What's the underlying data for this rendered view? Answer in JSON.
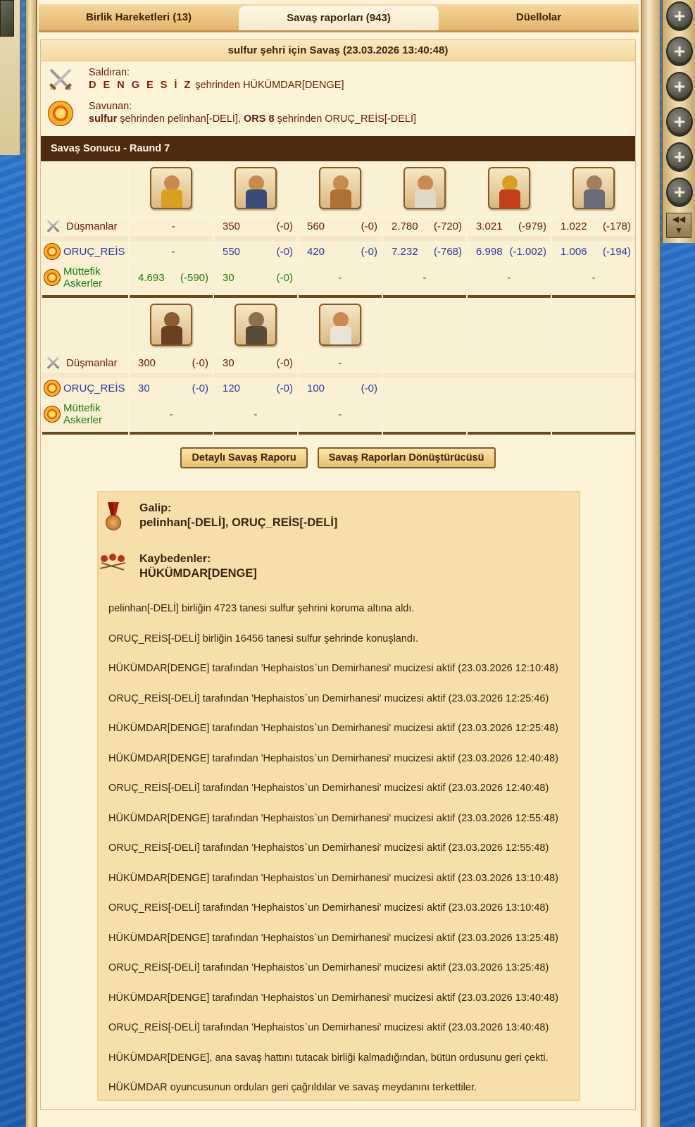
{
  "tabs": [
    {
      "label": "Birlik Hareketleri (13)"
    },
    {
      "label": "Savaş raporları (943)"
    },
    {
      "label": "Düellolar"
    }
  ],
  "report": {
    "title": "sulfur şehri için Savaş (23.03.2026 13:40:48)",
    "attacker_label": "Saldıran:",
    "attacker_city": "D E N G E S İ Z",
    "attacker_rest": " şehrinden HÜKÜMDAR[DENGE]",
    "defender_label": "Savunan:",
    "defender_city1": "sulfur",
    "defender_rest1": " şehrinden pelinhan[-DELİ], ",
    "defender_city2": "ORS 8",
    "defender_rest2": " şehrinden ORUÇ_REİS[-DELİ]",
    "result_bar": "Savaş Sonucu - Raund 7"
  },
  "rows": {
    "enemies": "Düşmanlar",
    "own": "ORUÇ_REİS",
    "allies": "Müttefik Askerler"
  },
  "block1": {
    "enemies": [
      [
        "-",
        ""
      ],
      [
        "350",
        "(-0)"
      ],
      [
        "560",
        "(-0)"
      ],
      [
        "2.780",
        "(-720)"
      ],
      [
        "3.021",
        "(-979)"
      ],
      [
        "1.022",
        "(-178)"
      ]
    ],
    "own": [
      [
        "-",
        ""
      ],
      [
        "550",
        "(-0)"
      ],
      [
        "420",
        "(-0)"
      ],
      [
        "7.232",
        "(-768)"
      ],
      [
        "6.998",
        "(-1.002)"
      ],
      [
        "1.006",
        "(-194)"
      ]
    ],
    "allies": [
      [
        "4.693",
        "(-590)"
      ],
      [
        "30",
        "(-0)"
      ],
      [
        "-",
        ""
      ],
      [
        "-",
        ""
      ],
      [
        "-",
        ""
      ],
      [
        "-",
        ""
      ]
    ]
  },
  "block2": {
    "enemies": [
      [
        "300",
        "(-0)"
      ],
      [
        "30",
        "(-0)"
      ],
      [
        "-",
        ""
      ]
    ],
    "own": [
      [
        "30",
        "(-0)"
      ],
      [
        "120",
        "(-0)"
      ],
      [
        "100",
        "(-0)"
      ]
    ],
    "allies": [
      [
        "-",
        ""
      ],
      [
        "-",
        ""
      ],
      [
        "-",
        ""
      ]
    ]
  },
  "buttons": {
    "detailed": "Detaylı Savaş Raporu",
    "converter": "Savaş Raporları Dönüştürücüsü"
  },
  "result": {
    "winner_label": "Galip:",
    "winners": "pelinhan[-DELİ], ORUÇ_REİS[-DELİ]",
    "loser_label": "Kaybedenler:",
    "losers": "HÜKÜMDAR[DENGE]"
  },
  "events": [
    "pelinhan[-DELİ] birliğin 4723 tanesi sulfur şehrini koruma altına aldı.",
    "ORUÇ_REİS[-DELİ] birliğin 16456 tanesi sulfur şehrinde konuşlandı.",
    "HÜKÜMDAR[DENGE] tarafından 'Hephaistos`un Demirhanesi' mucizesi aktif (23.03.2026 12:10:48)",
    "ORUÇ_REİS[-DELİ] tarafından 'Hephaistos`un Demirhanesi' mucizesi aktif (23.03.2026 12:25:46)",
    "HÜKÜMDAR[DENGE] tarafından 'Hephaistos`un Demirhanesi' mucizesi aktif (23.03.2026 12:25:48)",
    "HÜKÜMDAR[DENGE] tarafından 'Hephaistos`un Demirhanesi' mucizesi aktif (23.03.2026 12:40:48)",
    "ORUÇ_REİS[-DELİ] tarafından 'Hephaistos`un Demirhanesi' mucizesi aktif (23.03.2026 12:40:48)",
    "HÜKÜMDAR[DENGE] tarafından 'Hephaistos`un Demirhanesi' mucizesi aktif (23.03.2026 12:55:48)",
    "ORUÇ_REİS[-DELİ] tarafından 'Hephaistos`un Demirhanesi' mucizesi aktif (23.03.2026 12:55:48)",
    "HÜKÜMDAR[DENGE] tarafından 'Hephaistos`un Demirhanesi' mucizesi aktif (23.03.2026 13:10:48)",
    "ORUÇ_REİS[-DELİ] tarafından 'Hephaistos`un Demirhanesi' mucizesi aktif (23.03.2026 13:10:48)",
    "HÜKÜMDAR[DENGE] tarafından 'Hephaistos`un Demirhanesi' mucizesi aktif (23.03.2026 13:25:48)",
    "ORUÇ_REİS[-DELİ] tarafından 'Hephaistos`un Demirhanesi' mucizesi aktif (23.03.2026 13:25:48)",
    "HÜKÜMDAR[DENGE] tarafından 'Hephaistos`un Demirhanesi' mucizesi aktif (23.03.2026 13:40:48)",
    "ORUÇ_REİS[-DELİ] tarafından 'Hephaistos`un Demirhanesi' mucizesi aktif (23.03.2026 13:40:48)",
    "HÜKÜMDAR[DENGE], ana savaş hattını tutacak birliği kalmadığından, bütün ordusunu geri çekti.",
    "HÜKÜMDAR oyuncusunun orduları geri çağrıldılar ve savaş meydanını terkettiler."
  ],
  "side_buttons": [
    "+",
    "+",
    "+",
    "+",
    "+",
    "+"
  ],
  "side_scroll": [
    "◀◀",
    "▼"
  ],
  "colors": {
    "panel_bg": "#fdf3d8",
    "result_bar": "#4d2a10",
    "enemy_text": "#6b1a05",
    "own_text": "#2a3aa0",
    "ally_text": "#1b7f10"
  },
  "icons": {
    "attacker": "crossed-swords-icon",
    "defender": "shield-icon",
    "winner": "medal-icon",
    "losers": "fallen-soldiers-icon",
    "units_block1": [
      "slinger-unit-icon",
      "hoplite-unit-icon",
      "horseman-unit-icon",
      "swordsman-unit-icon",
      "spartan-hoplite-unit-icon",
      "catapult-unit-icon"
    ],
    "units_block2": [
      "chariot-unit-icon",
      "siege-unit-icon",
      "sage-unit-icon"
    ]
  }
}
